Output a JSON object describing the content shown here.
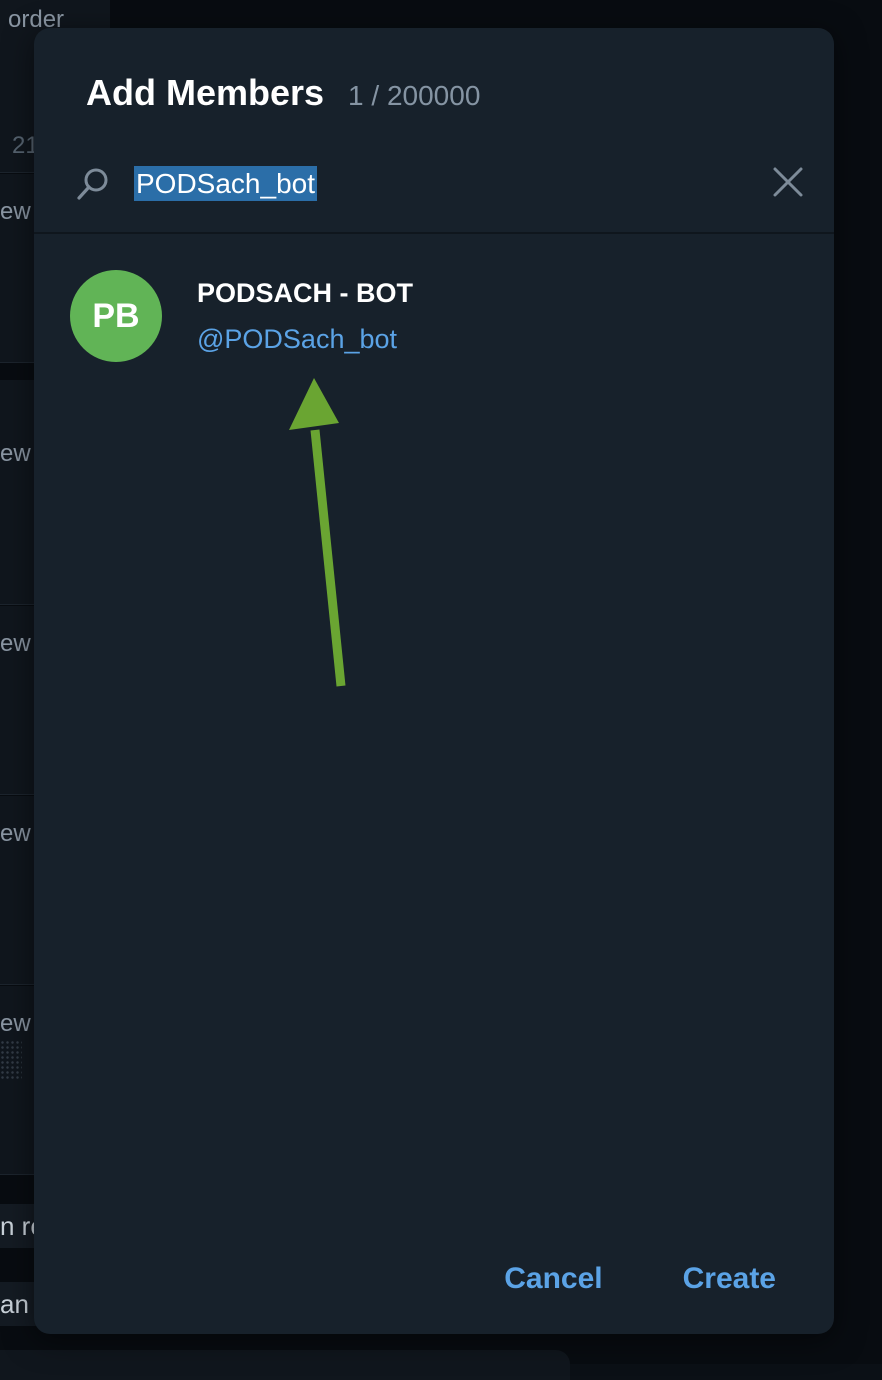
{
  "background": {
    "top_text": "order",
    "partial_number": "21",
    "list_snippets": [
      "ew",
      "ew",
      "ew",
      "ew",
      "ew"
    ],
    "bottom_snippets": [
      "n re",
      "an"
    ]
  },
  "dialog": {
    "title": "Add Members",
    "member_count": "1 / 200000",
    "search": {
      "value": "PODSach_bot",
      "icon": "search-icon",
      "clear_icon": "close-icon"
    },
    "results": [
      {
        "avatar_initials": "PB",
        "avatar_color": "#61b456",
        "name": "PODSACH - BOT",
        "username": "@PODSach_bot"
      }
    ],
    "buttons": {
      "cancel": "Cancel",
      "create": "Create"
    }
  },
  "colors": {
    "accent": "#5ba3e6",
    "dialog_bg": "#17212b",
    "arrow": "#6aa532"
  }
}
